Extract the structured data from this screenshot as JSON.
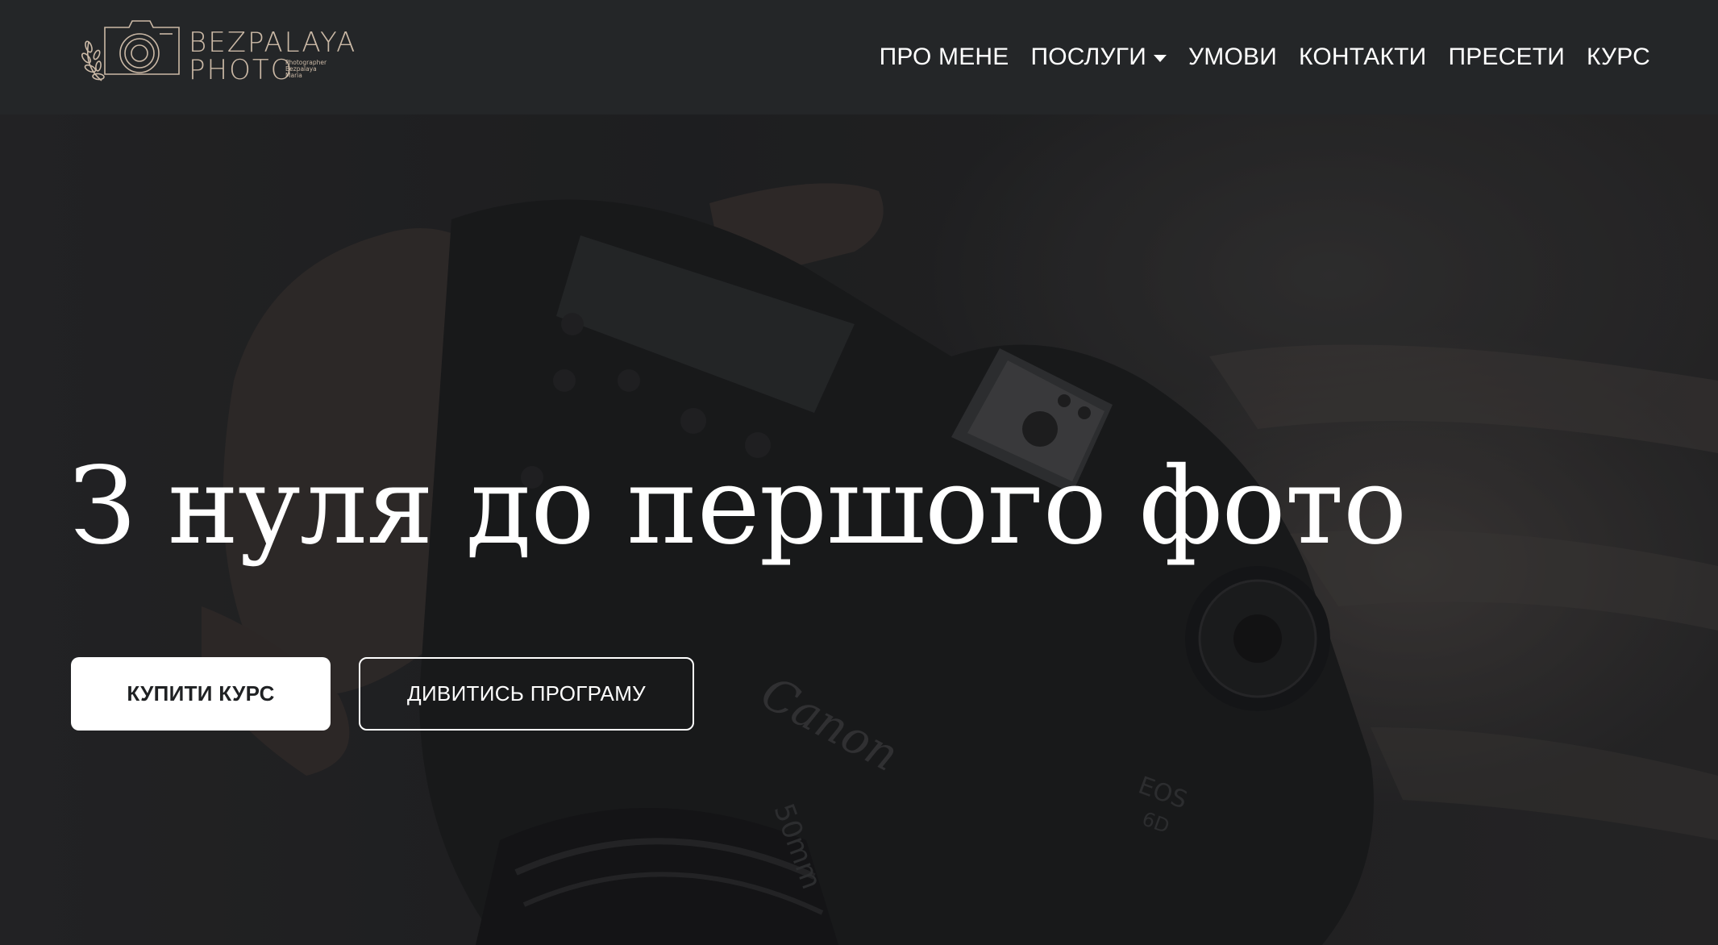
{
  "header": {
    "logo": {
      "line1": "BEZPALAYA",
      "line2": "PHOTO",
      "small_lines": [
        "Photographer",
        "Bezpalaya",
        "Maria"
      ]
    },
    "nav": [
      {
        "label": "ПРО МЕНЕ"
      },
      {
        "label": "ПОСЛУГИ",
        "has_dropdown": true
      },
      {
        "label": "УМОВИ"
      },
      {
        "label": "КОНТАКТИ"
      },
      {
        "label": "ПРЕСЕТИ"
      },
      {
        "label": "КУРС"
      }
    ]
  },
  "hero": {
    "title": "З нуля до першого фото",
    "buttons": {
      "buy": "КУПИТИ КУРС",
      "program": "ДИВИТИСЬ ПРОГРАМУ"
    },
    "camera_markings": {
      "brand": "Canon",
      "model": "EOS",
      "model_sub": "6D",
      "lens": "50mm"
    }
  },
  "colors": {
    "header_bg": "#242628",
    "logo_accent": "#cbb9a6",
    "text_light": "#ffffff",
    "button_text_dark": "#1f2123"
  }
}
